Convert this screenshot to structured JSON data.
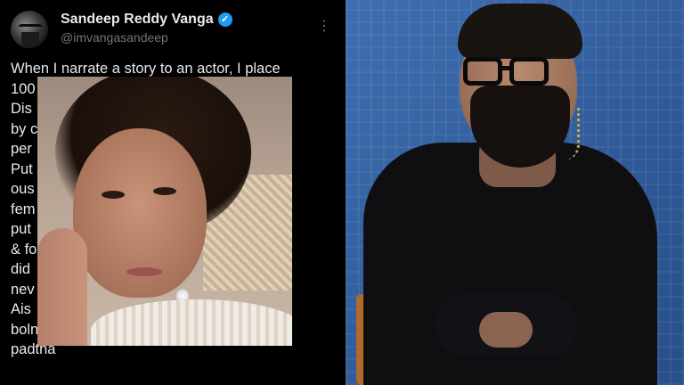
{
  "tweet": {
    "display_name": "Sandeep Reddy Vanga",
    "verified_icon": "verified-badge-icon",
    "handle": "@imvangasandeep",
    "more_icon": "more-options-icon",
    "text": "When I narrate a story to an actor, I place\n100                              (Non\nDis                              . But\nby c                               he\nper\nPut\nous\nfem                              er, I\nput                              raft\n& fo                              You\ndid                              ll\nnev\nAis\nbolna... kyunki mujhe jarra bhi farak nahi\npadtha"
  },
  "colors": {
    "tweet_bg": "#000000",
    "text": "#e7e9ea",
    "muted": "#71767b",
    "verified": "#1d9bf0",
    "photo_bg": "#2f5a98"
  }
}
